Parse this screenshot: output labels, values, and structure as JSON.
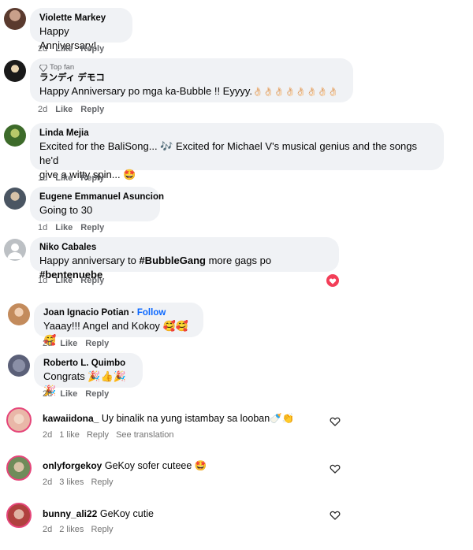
{
  "comments": [
    {
      "name": "Violette Markey",
      "text": "Happy Anniversary!",
      "time": "2d",
      "like": "Like",
      "reply": "Reply"
    },
    {
      "badge": "Top fan",
      "name": "ランディ デモコ",
      "text": "Happy Anniversary po mga ka-Bubble !! Eyyyy.",
      "time": "2d",
      "like": "Like",
      "reply": "Reply"
    },
    {
      "name": "Linda Mejia",
      "text_line1": "Excited for the BaliSong... 🎶 Excited for Michael V's musical genius and the songs he'd",
      "text_line2": "give a witty spin... 🤩",
      "time": "1d",
      "like": "Like",
      "reply": "Reply"
    },
    {
      "name": "Eugene Emmanuel Asuncion",
      "text": "Going to 30",
      "time": "1d",
      "like": "Like",
      "reply": "Reply"
    },
    {
      "name": "Niko Cabales",
      "text_pre": "Happy anniversary to ",
      "tag1": "#BubbleGang",
      "text_mid": " more gags po ",
      "tag2": "#bentenuebe",
      "time": "1d",
      "like": "Like",
      "reply": "Reply"
    },
    {
      "name": "Joan Ignacio Potian",
      "follow": "Follow",
      "text": "Yaaay!!! Angel and Kokoy 🥰🥰🥰",
      "time": "2d",
      "like": "Like",
      "reply": "Reply"
    },
    {
      "name": "Roberto L. Quimbo",
      "text": "Congrats 🎉👍🎉🎉",
      "time": "2d",
      "like": "Like",
      "reply": "Reply"
    }
  ],
  "ig_comments": [
    {
      "name": "kawaiidona_",
      "text": "Uy binalik na yung istambay sa looban🍼👏",
      "time": "2d",
      "likes": "1 like",
      "reply": "Reply",
      "translate": "See translation"
    },
    {
      "name": "onlyforgekoy",
      "text": "GeKoy sofer cuteee 🤩",
      "time": "2d",
      "likes": "3 likes",
      "reply": "Reply"
    },
    {
      "name": "bunny_ali22",
      "text": "GeKoy cutie",
      "time": "2d",
      "likes": "2 likes",
      "reply": "Reply"
    }
  ],
  "colors": {
    "bubble": "#f0f2f5",
    "meta": "#65676b",
    "link": "#0866ff",
    "heart_react": "#f33e58"
  }
}
